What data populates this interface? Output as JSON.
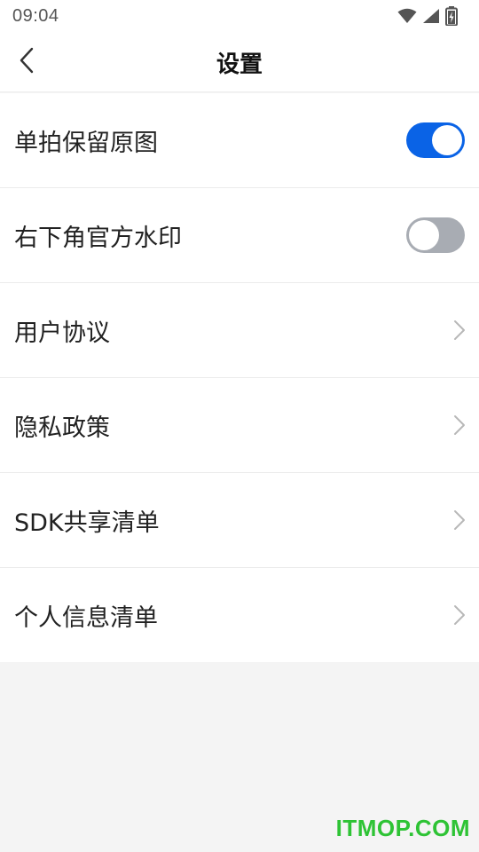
{
  "status_bar": {
    "time": "09:04",
    "icons": [
      "wifi-icon",
      "signal-icon",
      "battery-charging-icon"
    ]
  },
  "nav": {
    "title": "设置",
    "back_icon": "chevron-left-icon"
  },
  "settings": {
    "items": [
      {
        "label": "单拍保留原图",
        "control": "toggle",
        "enabled": true
      },
      {
        "label": "右下角官方水印",
        "control": "toggle",
        "enabled": false
      },
      {
        "label": "用户协议",
        "control": "chevron"
      },
      {
        "label": "隐私政策",
        "control": "chevron"
      },
      {
        "label": "SDK共享清单",
        "control": "chevron"
      },
      {
        "label": "个人信息清单",
        "control": "chevron"
      }
    ]
  },
  "watermark": {
    "text": "ITMOP.COM"
  },
  "colors": {
    "toggle_on": "#0a63e6",
    "toggle_off": "#a8acb3",
    "watermark": "#2ec335",
    "background": "#f4f4f4"
  }
}
